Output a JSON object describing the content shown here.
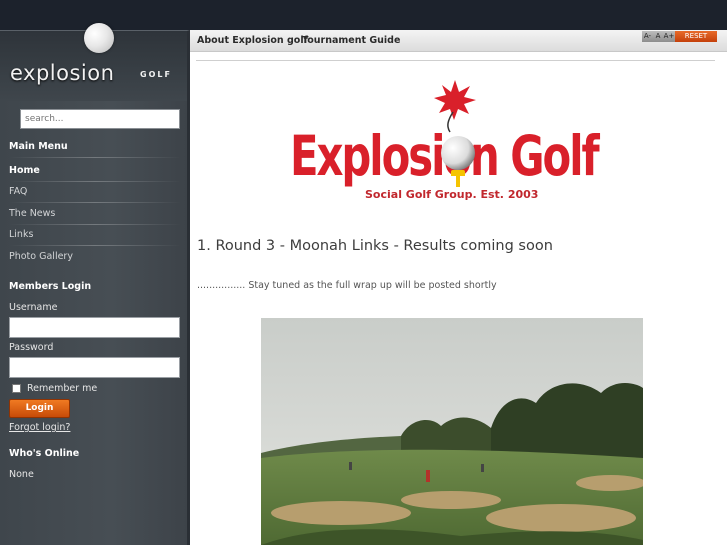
{
  "sidebar": {
    "logo_text": "explosion",
    "logo_sub": "GOLF",
    "search_placeholder": "search...",
    "main_menu_title": "Main Menu",
    "menu_items": [
      {
        "label": "Home",
        "active": true
      },
      {
        "label": "FAQ"
      },
      {
        "label": "The News"
      },
      {
        "label": "Links"
      },
      {
        "label": "Photo Gallery"
      }
    ],
    "members_login_title": "Members Login",
    "username_label": "Username",
    "password_label": "Password",
    "remember_label": "Remember me",
    "login_button": "Login",
    "forgot_login": "Forgot login?",
    "whos_online_title": "Who's Online",
    "whos_online_value": "None"
  },
  "navbar": {
    "links": [
      "About Explosion golf",
      "Tournament Guide"
    ],
    "font_controls": [
      "A-",
      "A",
      "A+",
      "RESET"
    ]
  },
  "main": {
    "logo_title": "Explosion Golf",
    "logo_subtitle": "Social Golf Group. Est. 2003",
    "headline": "1. Round 3 - Moonah Links - Results coming soon",
    "intro": "................ Stay tuned as the full wrap up will be posted shortly"
  },
  "colors": {
    "logo_red": "#d9202a",
    "logo_subtitle_red": "#c1272d",
    "sidebar_bg": "#454c52",
    "login_orange": "#e0601a",
    "topbar": "#1c222c"
  }
}
